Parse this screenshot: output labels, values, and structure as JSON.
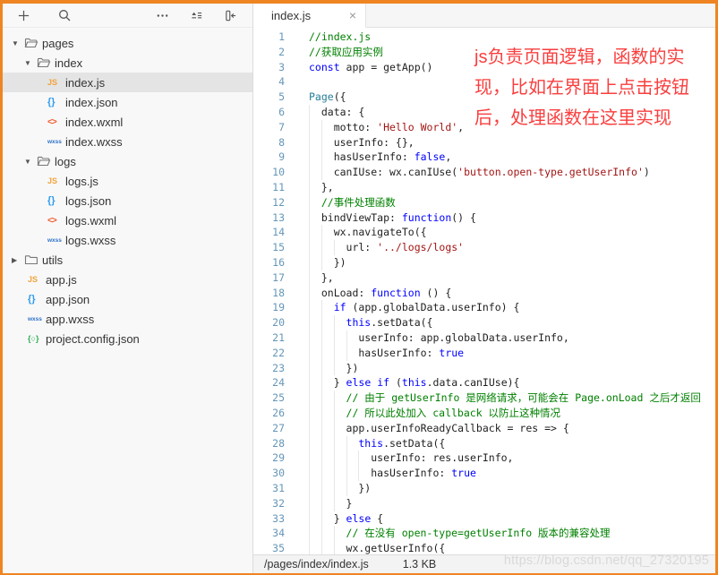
{
  "colors": {
    "frame": "#ef8522",
    "annotation_red": "#fa3e3e",
    "selection_gray": "#e4e4e4"
  },
  "toolbar": {
    "icons": [
      "new-file-icon",
      "search-icon",
      "more-icon",
      "collapse-all-icon",
      "toggle-sidebar-icon"
    ]
  },
  "sidebar": {
    "items": [
      {
        "label": "pages",
        "icon": "folder-open",
        "arrow": "down",
        "indent": 0
      },
      {
        "label": "index",
        "icon": "folder-open",
        "arrow": "down",
        "indent": 1
      },
      {
        "label": "index.js",
        "icon": "js",
        "indent": 2,
        "selected": true
      },
      {
        "label": "index.json",
        "icon": "json",
        "indent": 2
      },
      {
        "label": "index.wxml",
        "icon": "wxml",
        "indent": 2
      },
      {
        "label": "index.wxss",
        "icon": "wxss",
        "indent": 2
      },
      {
        "label": "logs",
        "icon": "folder-open",
        "arrow": "down",
        "indent": 1
      },
      {
        "label": "logs.js",
        "icon": "js",
        "indent": 2
      },
      {
        "label": "logs.json",
        "icon": "json",
        "indent": 2
      },
      {
        "label": "logs.wxml",
        "icon": "wxml",
        "indent": 2
      },
      {
        "label": "logs.wxss",
        "icon": "wxss",
        "indent": 2
      },
      {
        "label": "utils",
        "icon": "folder",
        "arrow": "right",
        "indent": 0
      },
      {
        "label": "app.js",
        "icon": "js",
        "indent": 1
      },
      {
        "label": "app.json",
        "icon": "json",
        "indent": 1
      },
      {
        "label": "app.wxss",
        "icon": "wxss",
        "indent": 1
      },
      {
        "label": "project.config.json",
        "icon": "config",
        "indent": 1
      }
    ]
  },
  "tabs": {
    "active_label": "index.js",
    "close_glyph": "×"
  },
  "editor": {
    "lines": [
      {
        "n": 1,
        "i": 0,
        "s": [
          [
            "c",
            "//index.js"
          ]
        ]
      },
      {
        "n": 2,
        "i": 0,
        "s": [
          [
            "c",
            "//获取应用实例"
          ]
        ]
      },
      {
        "n": 3,
        "i": 0,
        "s": [
          [
            "k",
            "const"
          ],
          [
            "p",
            " app = getApp()"
          ]
        ]
      },
      {
        "n": 4,
        "i": 0,
        "s": []
      },
      {
        "n": 5,
        "i": 0,
        "s": [
          [
            "f",
            "Page"
          ],
          [
            "p",
            "({"
          ]
        ]
      },
      {
        "n": 6,
        "i": 1,
        "s": [
          [
            "p",
            "data: {"
          ]
        ]
      },
      {
        "n": 7,
        "i": 2,
        "s": [
          [
            "p",
            "motto: "
          ],
          [
            "s",
            "'Hello World'"
          ],
          [
            "p",
            ","
          ]
        ]
      },
      {
        "n": 8,
        "i": 2,
        "s": [
          [
            "p",
            "userInfo: {},"
          ]
        ]
      },
      {
        "n": 9,
        "i": 2,
        "s": [
          [
            "p",
            "hasUserInfo: "
          ],
          [
            "k",
            "false"
          ],
          [
            "p",
            ","
          ]
        ]
      },
      {
        "n": 10,
        "i": 2,
        "s": [
          [
            "p",
            "canIUse: wx.canIUse("
          ],
          [
            "s",
            "'button.open-type.getUserInfo'"
          ],
          [
            "p",
            ")"
          ]
        ]
      },
      {
        "n": 11,
        "i": 1,
        "s": [
          [
            "p",
            "},"
          ]
        ]
      },
      {
        "n": 12,
        "i": 1,
        "s": [
          [
            "c",
            "//事件处理函数"
          ]
        ]
      },
      {
        "n": 13,
        "i": 1,
        "s": [
          [
            "p",
            "bindViewTap: "
          ],
          [
            "k",
            "function"
          ],
          [
            "p",
            "() {"
          ]
        ]
      },
      {
        "n": 14,
        "i": 2,
        "s": [
          [
            "p",
            "wx.navigateTo({"
          ]
        ]
      },
      {
        "n": 15,
        "i": 3,
        "s": [
          [
            "p",
            "url: "
          ],
          [
            "s",
            "'../logs/logs'"
          ]
        ]
      },
      {
        "n": 16,
        "i": 2,
        "s": [
          [
            "p",
            "})"
          ]
        ]
      },
      {
        "n": 17,
        "i": 1,
        "s": [
          [
            "p",
            "},"
          ]
        ]
      },
      {
        "n": 18,
        "i": 1,
        "s": [
          [
            "p",
            "onLoad: "
          ],
          [
            "k",
            "function"
          ],
          [
            "p",
            " () {"
          ]
        ]
      },
      {
        "n": 19,
        "i": 2,
        "s": [
          [
            "k",
            "if"
          ],
          [
            "p",
            " (app.globalData.userInfo) {"
          ]
        ]
      },
      {
        "n": 20,
        "i": 3,
        "s": [
          [
            "k",
            "this"
          ],
          [
            "p",
            ".setData({"
          ]
        ]
      },
      {
        "n": 21,
        "i": 4,
        "s": [
          [
            "p",
            "userInfo: app.globalData.userInfo,"
          ]
        ]
      },
      {
        "n": 22,
        "i": 4,
        "s": [
          [
            "p",
            "hasUserInfo: "
          ],
          [
            "k",
            "true"
          ]
        ]
      },
      {
        "n": 23,
        "i": 3,
        "s": [
          [
            "p",
            "})"
          ]
        ]
      },
      {
        "n": 24,
        "i": 2,
        "s": [
          [
            "p",
            "} "
          ],
          [
            "k",
            "else"
          ],
          [
            "p",
            " "
          ],
          [
            "k",
            "if"
          ],
          [
            "p",
            " ("
          ],
          [
            "k",
            "this"
          ],
          [
            "p",
            ".data.canIUse){"
          ]
        ]
      },
      {
        "n": 25,
        "i": 3,
        "s": [
          [
            "c",
            "// 由于 getUserInfo 是网络请求，可能会在 Page.onLoad 之后才返回"
          ]
        ]
      },
      {
        "n": 26,
        "i": 3,
        "s": [
          [
            "c",
            "// 所以此处加入 callback 以防止这种情况"
          ]
        ]
      },
      {
        "n": 27,
        "i": 3,
        "s": [
          [
            "p",
            "app.userInfoReadyCallback = res => {"
          ]
        ]
      },
      {
        "n": 28,
        "i": 4,
        "s": [
          [
            "k",
            "this"
          ],
          [
            "p",
            ".setData({"
          ]
        ]
      },
      {
        "n": 29,
        "i": 5,
        "s": [
          [
            "p",
            "userInfo: res.userInfo,"
          ]
        ]
      },
      {
        "n": 30,
        "i": 5,
        "s": [
          [
            "p",
            "hasUserInfo: "
          ],
          [
            "k",
            "true"
          ]
        ]
      },
      {
        "n": 31,
        "i": 4,
        "s": [
          [
            "p",
            "})"
          ]
        ]
      },
      {
        "n": 32,
        "i": 3,
        "s": [
          [
            "p",
            "}"
          ]
        ]
      },
      {
        "n": 33,
        "i": 2,
        "s": [
          [
            "p",
            "} "
          ],
          [
            "k",
            "else"
          ],
          [
            "p",
            " {"
          ]
        ]
      },
      {
        "n": 34,
        "i": 3,
        "s": [
          [
            "c",
            "// 在没有 open-type=getUserInfo 版本的兼容处理"
          ]
        ]
      },
      {
        "n": 35,
        "i": 3,
        "s": [
          [
            "p",
            "wx.getUserInfo({"
          ]
        ]
      }
    ]
  },
  "annotation": {
    "lines": [
      "js负责页面逻辑，函数的实",
      "现，比如在界面上点击按钮",
      "后，处理函数在这里实现"
    ]
  },
  "statusbar": {
    "path": "/pages/index/index.js",
    "size": "1.3 KB"
  },
  "watermark": "https://blog.csdn.net/qq_27320195"
}
